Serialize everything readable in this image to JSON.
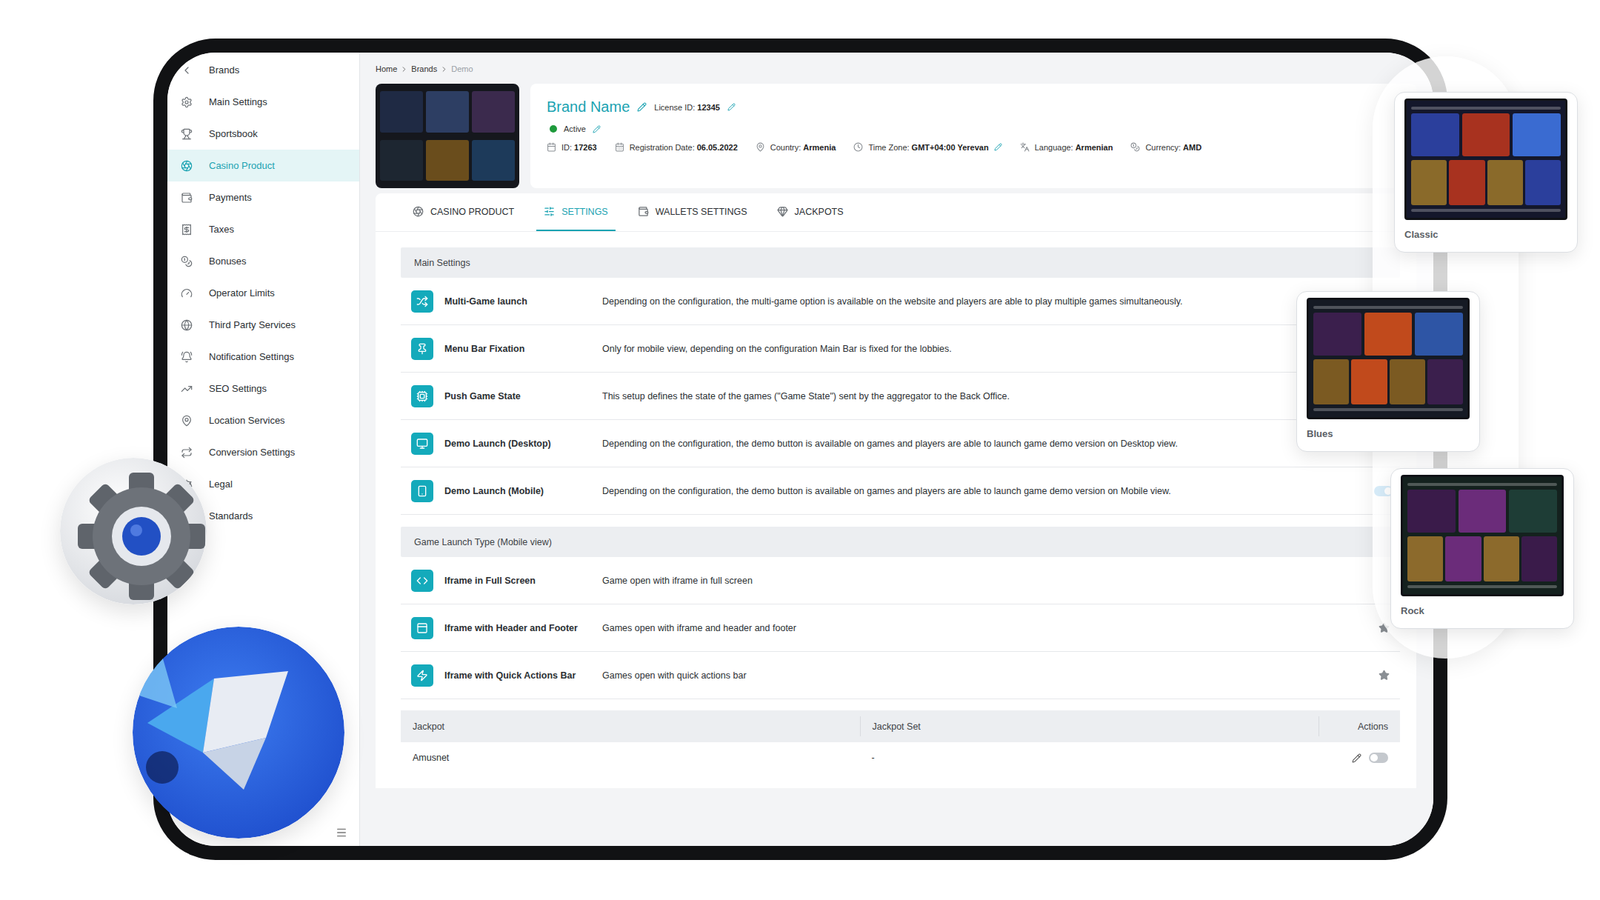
{
  "sidebar": {
    "items": [
      {
        "label": "Brands",
        "selected": false
      },
      {
        "label": "Main Settings",
        "selected": false
      },
      {
        "label": "Sportsbook",
        "selected": false
      },
      {
        "label": "Casino Product",
        "selected": true
      },
      {
        "label": "Payments",
        "selected": false
      },
      {
        "label": "Taxes",
        "selected": false
      },
      {
        "label": "Bonuses",
        "selected": false
      },
      {
        "label": "Operator Limits",
        "selected": false
      },
      {
        "label": "Third Party Services",
        "selected": false
      },
      {
        "label": "Notification Settings",
        "selected": false
      },
      {
        "label": "SEO Settings",
        "selected": false
      },
      {
        "label": "Location Services",
        "selected": false
      },
      {
        "label": "Conversion Settings",
        "selected": false
      },
      {
        "label": "Legal",
        "selected": false
      },
      {
        "label": "Standards",
        "selected": false
      }
    ]
  },
  "breadcrumb": [
    {
      "label": "Home",
      "current": false
    },
    {
      "label": "Brands",
      "current": false
    },
    {
      "label": "Demo",
      "current": true
    }
  ],
  "brand": {
    "name": "Brand Name",
    "license_label": "License ID:",
    "license": "12345",
    "status": "Active",
    "active": true,
    "meta": [
      {
        "label": "ID:",
        "value": "17263"
      },
      {
        "label": "Registration Date:",
        "value": "06.05.2022"
      },
      {
        "label": "Country:",
        "value": "Armenia"
      },
      {
        "label": "Time Zone:",
        "value": "GMT+04:00 Yerevan",
        "editable": true
      },
      {
        "label": "Language:",
        "value": "Armenian"
      },
      {
        "label": "Currency:",
        "value": "AMD"
      }
    ]
  },
  "tabs": [
    {
      "label": "CASINO PRODUCT",
      "selected": false
    },
    {
      "label": "SETTINGS",
      "selected": true
    },
    {
      "label": "WALLETS SETTINGS",
      "selected": false
    },
    {
      "label": "JACKPOTS",
      "selected": false
    }
  ],
  "sections": [
    {
      "title": "Main Settings",
      "rows": [
        {
          "label": "Multi-Game launch",
          "description": "Depending on the configuration, the multi-game option is available on the website and players are able to play multiple games simultaneously.",
          "kind": "none"
        },
        {
          "label": "Menu Bar Fixation",
          "description": "Only for mobile view, depending on the configuration Main Bar is fixed for the lobbies.",
          "kind": "none"
        },
        {
          "label": "Push Game State",
          "description": "This setup defines the state of the games (\"Game State\") sent by the aggregator to the Back Office.",
          "kind": "none"
        },
        {
          "label": "Demo Launch (Desktop)",
          "description": "Depending on the configuration, the demo button is available on games and players are able to launch game demo version on Desktop view.",
          "kind": "none"
        },
        {
          "label": "Demo Launch (Mobile)",
          "description": "Depending on the configuration, the demo button is available on games and players are able to launch game demo version on Mobile view.",
          "kind": "toggle",
          "on": true
        }
      ]
    },
    {
      "title": "Game Launch Type (Mobile view)",
      "rows": [
        {
          "label": "Iframe in Full Screen",
          "description": "Game open with iframe in full screen",
          "kind": "none"
        },
        {
          "label": "Iframe with Header and Footer",
          "description": "Games open with iframe and header and footer",
          "kind": "star",
          "starred": false
        },
        {
          "label": "Iframe with Quick Actions Bar",
          "description": "Games open with quick actions bar",
          "kind": "star",
          "starred": false
        }
      ]
    }
  ],
  "jackpot_table": {
    "columns": [
      "Jackpot",
      "Jackpot Set",
      "Actions"
    ],
    "rows": [
      {
        "name": "Amusnet",
        "set": "-",
        "on": false
      }
    ]
  },
  "themes": [
    {
      "name": "Classic"
    },
    {
      "name": "Blues"
    },
    {
      "name": "Rock"
    }
  ]
}
